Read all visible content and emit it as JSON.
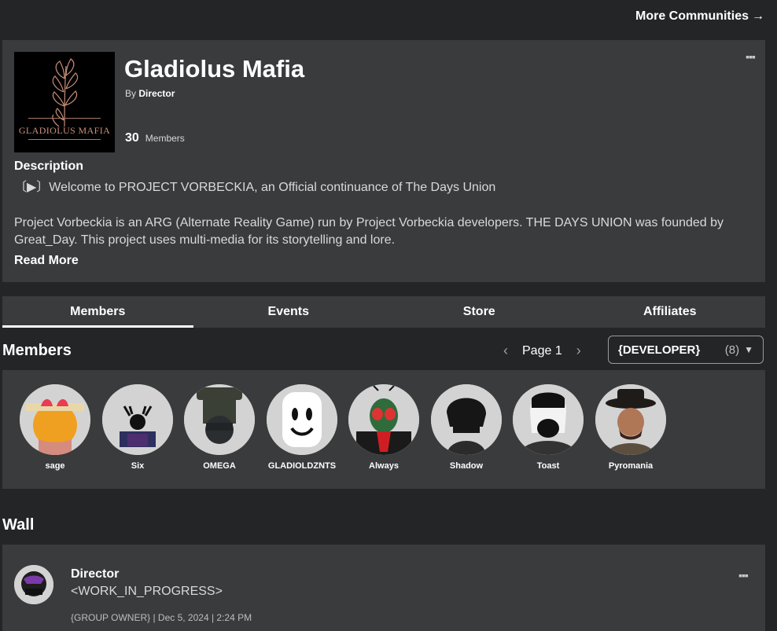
{
  "top": {
    "more_communities": "More Communities",
    "arrow_icon": "arrow-right-icon"
  },
  "group": {
    "logo_text": "GLADIOLUS MAFIA",
    "name": "Gladiolus Mafia",
    "by_label": "By",
    "owner": "Director",
    "member_count": "30",
    "members_label": "Members",
    "menu_icon": "more-dots-icon",
    "description_heading": "Description",
    "description_line1": "〔▶〕Welcome to PROJECT VORBECKIA, an Official continuance of The Days Union",
    "description_line2": "Project Vorbeckia is an ARG (Alternate Reality Game) run by Project Vorbeckia developers. THE DAYS UNION was founded by Great_Day. This project uses multi-media for its storytelling and lore.",
    "read_more": "Read More"
  },
  "tabs": [
    {
      "label": "Members",
      "active": true
    },
    {
      "label": "Events"
    },
    {
      "label": "Store"
    },
    {
      "label": "Affiliates"
    }
  ],
  "members_section": {
    "heading": "Members",
    "page_label": "Page 1",
    "role": "{DEVELOPER}",
    "role_count": "(8)",
    "members": [
      {
        "name": "sage"
      },
      {
        "name": "Six"
      },
      {
        "name": "OMEGA"
      },
      {
        "name": "GLADIOLDZNTS"
      },
      {
        "name": "Always"
      },
      {
        "name": "Shadow"
      },
      {
        "name": "Toast"
      },
      {
        "name": "Pyromania"
      }
    ]
  },
  "wall": {
    "heading": "Wall",
    "post": {
      "author": "Director",
      "text": "<WORK_IN_PROGRESS>",
      "meta": "{GROUP OWNER} | Dec 5, 2024 | 2:24 PM"
    }
  },
  "colors": {
    "background": "#232527",
    "card": "#393b3d",
    "text": "#ffffff",
    "muted": "#d9d9d9"
  }
}
